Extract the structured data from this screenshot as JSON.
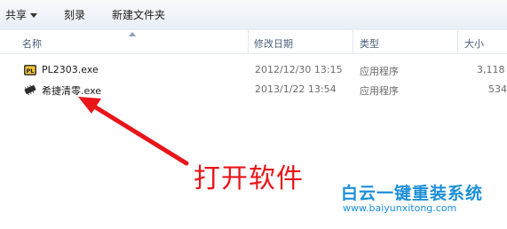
{
  "toolbar": {
    "share_label": "共享",
    "burn_label": "刻录",
    "new_folder_label": "新建文件夹"
  },
  "columns": {
    "name": "名称",
    "modified": "修改日期",
    "type": "类型",
    "size": "大小"
  },
  "files": [
    {
      "name": "PL2303.exe",
      "modified": "2012/12/30 13:15",
      "type": "应用程序",
      "size": "3,118",
      "icon": "pl2303-app-icon"
    },
    {
      "name": "希捷清零.exe",
      "modified": "2013/1/22 13:54",
      "type": "应用程序",
      "size": "534",
      "icon": "chip-app-icon"
    }
  ],
  "annotation": {
    "text": "打开软件",
    "color": "#e8151a"
  },
  "watermark": {
    "title": "白云一键重装系统",
    "url": "www.baiyunxitong.com",
    "color": "#1a8fd8"
  }
}
